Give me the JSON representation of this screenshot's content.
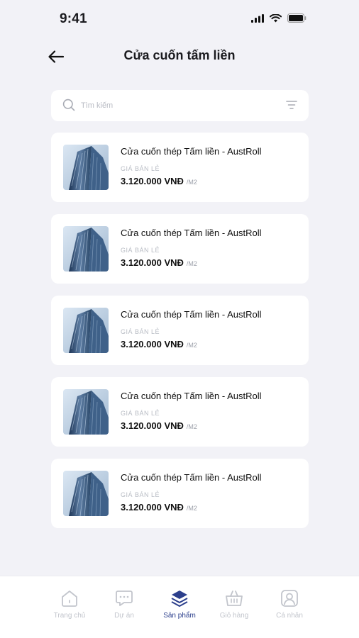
{
  "status_bar": {
    "time": "9:41"
  },
  "header": {
    "title": "Cửa cuốn tấm liền"
  },
  "search": {
    "placeholder": "Tìm kiếm",
    "value": ""
  },
  "products": [
    {
      "name": "Cửa cuốn thép Tấm liền - AustRoll",
      "price_label": "GIÁ BÁN LẺ",
      "price": "3.120.000 VNĐ",
      "unit": "/M2"
    },
    {
      "name": "Cửa cuốn thép Tấm liền - AustRoll",
      "price_label": "GIÁ BÁN LẺ",
      "price": "3.120.000 VNĐ",
      "unit": "/M2"
    },
    {
      "name": "Cửa cuốn thép Tấm liền - AustRoll",
      "price_label": "GIÁ BÁN LẺ",
      "price": "3.120.000 VNĐ",
      "unit": "/M2"
    },
    {
      "name": "Cửa cuốn thép Tấm liền - AustRoll",
      "price_label": "GIÁ BÁN LẺ",
      "price": "3.120.000 VNĐ",
      "unit": "/M2"
    },
    {
      "name": "Cửa cuốn thép Tấm liền - AustRoll",
      "price_label": "GIÁ BÁN LẺ",
      "price": "3.120.000 VNĐ",
      "unit": "/M2"
    }
  ],
  "tabbar": {
    "items": [
      {
        "label": "Trang chủ",
        "icon": "home-icon",
        "active": false
      },
      {
        "label": "Dự án",
        "icon": "chat-icon",
        "active": false
      },
      {
        "label": "Sản phẩm",
        "icon": "layers-icon",
        "active": true
      },
      {
        "label": "Giỏ hàng",
        "icon": "basket-icon",
        "active": false
      },
      {
        "label": "Cá nhân",
        "icon": "profile-icon",
        "active": false
      }
    ]
  },
  "colors": {
    "background": "#f2f2f7",
    "accent": "#2c3f8c",
    "inactive": "#c2c5cc"
  }
}
